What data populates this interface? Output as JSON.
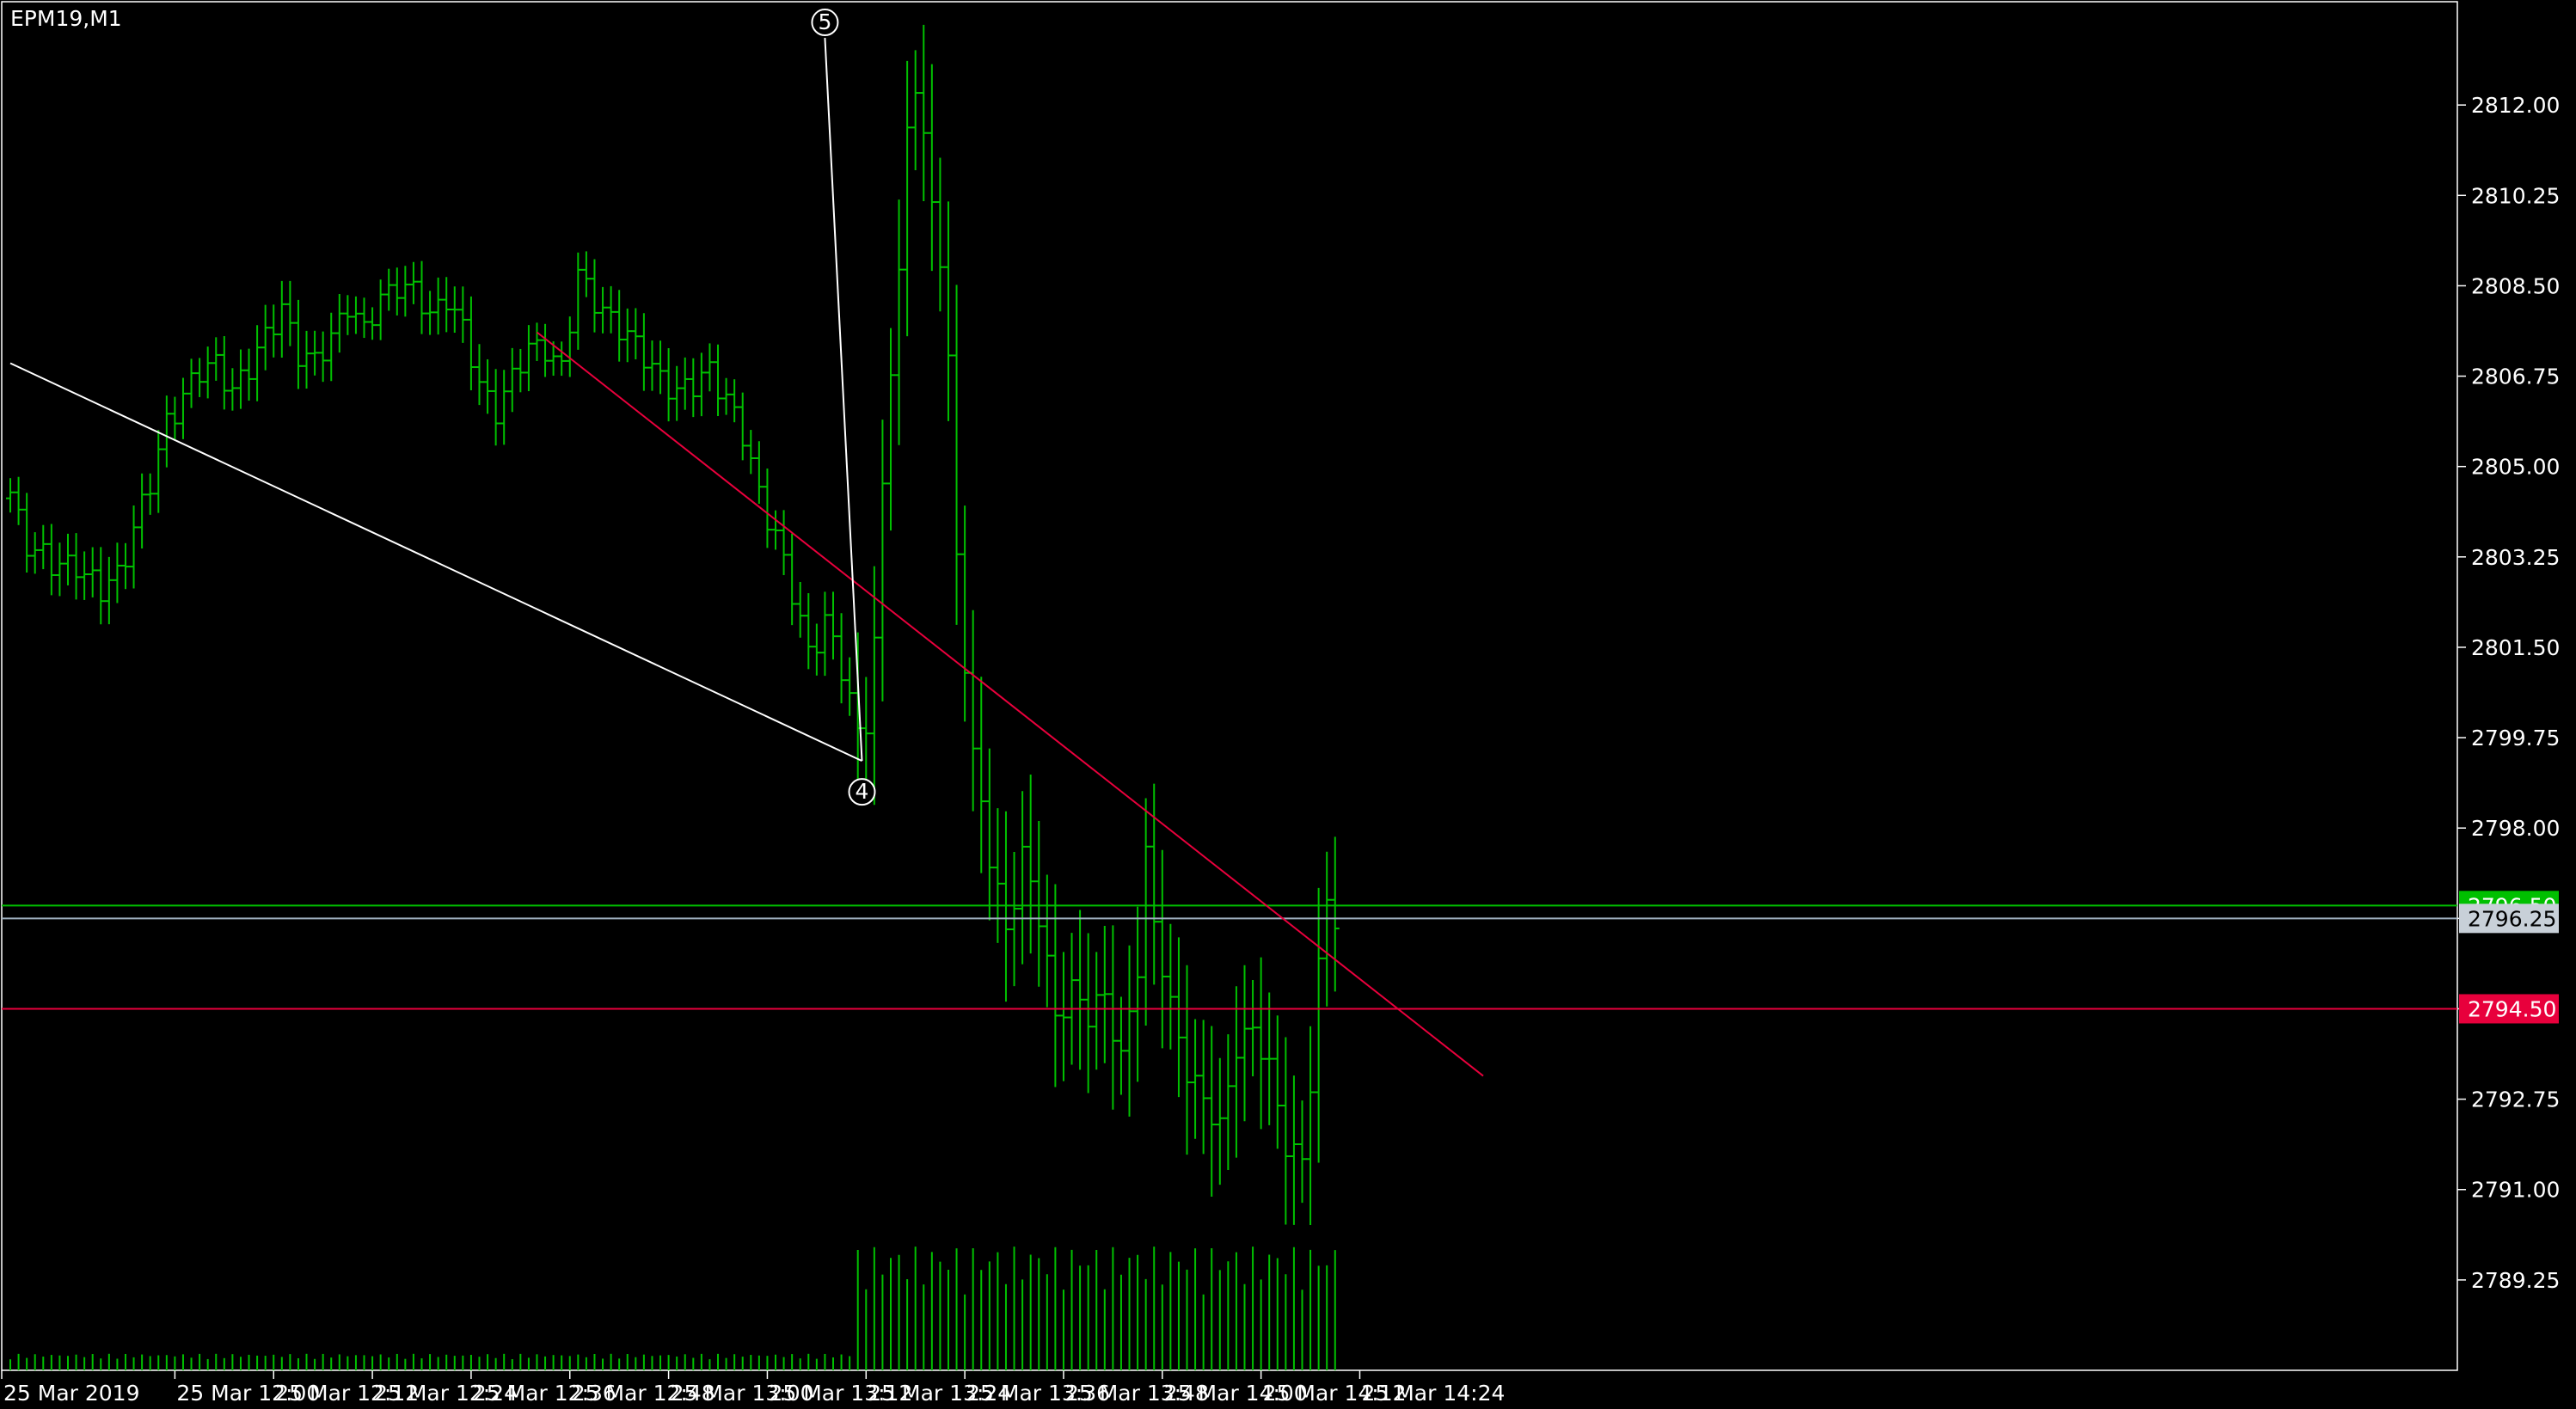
{
  "window": {
    "title": "EPM19,M1"
  },
  "colors": {
    "background": "#000000",
    "foreground": "#ffffff",
    "bar": "#00c000",
    "volume": "#00c000",
    "trendline_red": "#e8003c",
    "trendline_white": "#ffffff",
    "ask_line": "#00c000",
    "bid_line": "#a0b0c0",
    "bid_badge_bg": "#c8d0d8",
    "ask_badge_bg": "#00c000",
    "level_badge_bg": "#e8003c"
  },
  "chart_data": {
    "type": "ohlc",
    "symbol": "EPM19",
    "timeframe": "M1",
    "ylim": [
      2787.5,
      2814.0
    ],
    "y_ticks": [
      "2812.00",
      "2810.25",
      "2808.50",
      "2806.75",
      "2805.00",
      "2803.25",
      "2801.50",
      "2799.75",
      "2798.00",
      "2796.25",
      "2794.50",
      "2792.75",
      "2791.00",
      "2789.25"
    ],
    "x_tick_labels": [
      "25 Mar 2019",
      "25 Mar 12:00",
      "25 Mar 12:12",
      "25 Mar 12:24",
      "25 Mar 12:36",
      "25 Mar 12:48",
      "25 Mar 13:00",
      "25 Mar 13:12",
      "25 Mar 13:24",
      "25 Mar 13:36",
      "25 Mar 13:48",
      "25 Mar 14:00",
      "25 Mar 14:12",
      "25 Mar 14:24"
    ],
    "x_tick_index": [
      0,
      20,
      32,
      44,
      56,
      68,
      80,
      92,
      104,
      116,
      128,
      140,
      152,
      164
    ],
    "close_path": [
      [
        0,
        2804.5
      ],
      [
        2,
        2803.6
      ],
      [
        5,
        2803.0
      ],
      [
        8,
        2803.2
      ],
      [
        11,
        2802.5
      ],
      [
        13,
        2802.9
      ],
      [
        15,
        2803.9
      ],
      [
        17,
        2804.6
      ],
      [
        19,
        2805.8
      ],
      [
        21,
        2806.5
      ],
      [
        23,
        2806.8
      ],
      [
        25,
        2806.9
      ],
      [
        27,
        2806.6
      ],
      [
        29,
        2806.9
      ],
      [
        31,
        2807.4
      ],
      [
        33,
        2808.2
      ],
      [
        35,
        2807.2
      ],
      [
        37,
        2806.9
      ],
      [
        39,
        2807.6
      ],
      [
        41,
        2808.2
      ],
      [
        43,
        2807.5
      ],
      [
        45,
        2808.3
      ],
      [
        47,
        2808.6
      ],
      [
        49,
        2808.3
      ],
      [
        51,
        2807.9
      ],
      [
        53,
        2808.4
      ],
      [
        55,
        2807.6
      ],
      [
        57,
        2806.5
      ],
      [
        59,
        2806.2
      ],
      [
        61,
        2806.7
      ],
      [
        63,
        2807.2
      ],
      [
        65,
        2807.4
      ],
      [
        67,
        2806.9
      ],
      [
        69,
        2808.6
      ],
      [
        71,
        2808.3
      ],
      [
        73,
        2807.9
      ],
      [
        75,
        2807.4
      ],
      [
        77,
        2807.2
      ],
      [
        79,
        2806.8
      ],
      [
        81,
        2806.3
      ],
      [
        83,
        2806.6
      ],
      [
        85,
        2807.0
      ],
      [
        87,
        2806.2
      ],
      [
        89,
        2805.6
      ],
      [
        91,
        2804.6
      ],
      [
        93,
        2803.6
      ],
      [
        95,
        2802.5
      ],
      [
        97,
        2801.5
      ],
      [
        99,
        2802.0
      ],
      [
        101,
        2801.0
      ],
      [
        103,
        2799.9
      ],
      [
        104,
        2800.2
      ],
      [
        105,
        2801.6
      ],
      [
        106,
        2804.5
      ],
      [
        107,
        2806.9
      ],
      [
        108,
        2808.6
      ],
      [
        109,
        2811.5
      ],
      [
        110,
        2812.6
      ],
      [
        111,
        2811.4
      ],
      [
        112,
        2810.0
      ],
      [
        113,
        2809.0
      ],
      [
        114,
        2806.9
      ],
      [
        115,
        2803.2
      ],
      [
        117,
        2799.5
      ],
      [
        119,
        2797.4
      ],
      [
        121,
        2795.9
      ],
      [
        123,
        2797.6
      ],
      [
        125,
        2796.3
      ],
      [
        127,
        2794.2
      ],
      [
        129,
        2795.0
      ],
      [
        131,
        2794.4
      ],
      [
        133,
        2794.6
      ],
      [
        135,
        2793.6
      ],
      [
        137,
        2795.4
      ],
      [
        138,
        2797.4
      ],
      [
        139,
        2796.0
      ],
      [
        141,
        2794.6
      ],
      [
        143,
        2793.4
      ],
      [
        145,
        2792.6
      ],
      [
        147,
        2792.2
      ],
      [
        149,
        2793.9
      ],
      [
        151,
        2794.0
      ],
      [
        153,
        2793.3
      ],
      [
        155,
        2792.0
      ],
      [
        157,
        2791.5
      ],
      [
        158,
        2793.0
      ],
      [
        159,
        2795.2
      ],
      [
        160,
        2796.6
      ],
      [
        161,
        2796.4
      ]
    ],
    "price_levels": [
      {
        "name": "ask",
        "value": 2796.5,
        "label": "2796.50"
      },
      {
        "name": "bid",
        "value": 2796.25,
        "label": "2796.25"
      },
      {
        "name": "horizontal-level",
        "value": 2794.5,
        "label": "2794.50"
      }
    ],
    "trendlines": [
      {
        "name": "red-trendline",
        "from": [
          64,
          2807.6
        ],
        "to": [
          179,
          2793.2
        ]
      },
      {
        "name": "white-trendline",
        "from": [
          0,
          2807.0
        ],
        "to": [
          103.5,
          2799.3
        ]
      },
      {
        "name": "white-wave-line",
        "from": [
          99,
          2813.3
        ],
        "to": [
          103.5,
          2799.3
        ]
      }
    ],
    "wave_labels": [
      {
        "text": "5",
        "x": 99,
        "y": 2813.6
      },
      {
        "text": "4",
        "x": 103.5,
        "y": 2798.7
      }
    ]
  }
}
